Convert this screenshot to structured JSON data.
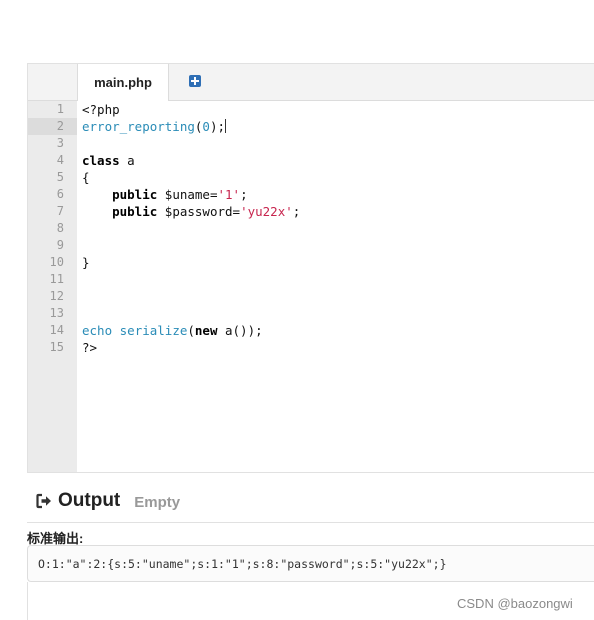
{
  "editor": {
    "tab_label": "main.php",
    "line_numbers": [
      "1",
      "2",
      "3",
      "4",
      "5",
      "6",
      "7",
      "8",
      "9",
      "10",
      "11",
      "12",
      "13",
      "14",
      "15"
    ],
    "active_line": 2
  },
  "code": {
    "l1": "<?php",
    "l2_fn": "error_reporting",
    "l2_open": "(",
    "l2_num": "0",
    "l2_close": ");",
    "l4_kw": "class",
    "l4_name": " a",
    "l5": "{",
    "l6_indent": "    ",
    "l6_kw": "public",
    "l6_var": " $uname=",
    "l6_str": "'1'",
    "l6_end": ";",
    "l7_indent": "    ",
    "l7_kw": "public",
    "l7_var": " $password=",
    "l7_str": "'yu22x'",
    "l7_end": ";",
    "l10": "}",
    "l14_echo": "echo",
    "l14_sp": " ",
    "l14_fn": "serialize",
    "l14_open": "(",
    "l14_new": "new",
    "l14_rest": " a());",
    "l15": "?>"
  },
  "output": {
    "title": "Output",
    "status": "Empty",
    "stdout_label": "标准输出:",
    "stdout_text": "O:1:\"a\":2:{s:5:\"uname\";s:1:\"1\";s:8:\"password\";s:5:\"yu22x\";}"
  },
  "watermark": "CSDN @baozongwi",
  "icons": {
    "add_tab": "plus-square-icon",
    "output": "sign-out-arrow-icon"
  }
}
